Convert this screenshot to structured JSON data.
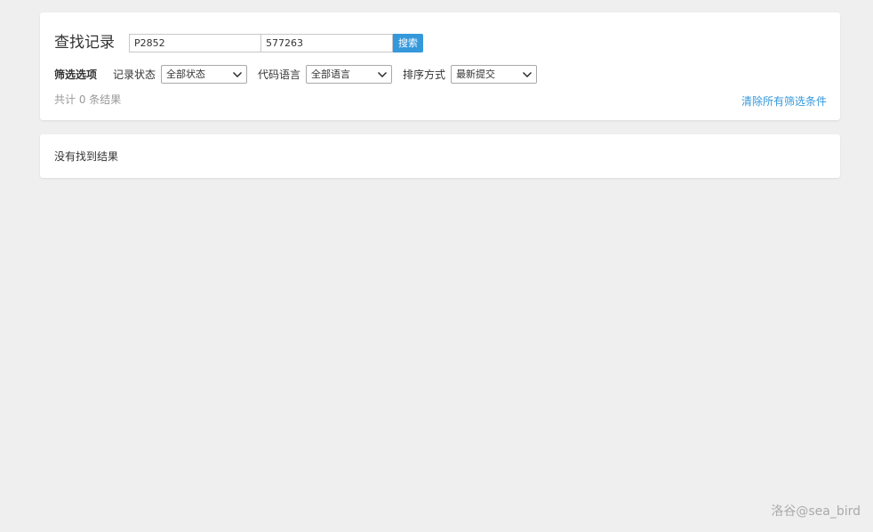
{
  "header": {
    "title": "查找记录",
    "search": {
      "problem_value": "P2852",
      "user_value": "577263",
      "button_label": "搜索"
    }
  },
  "filters": {
    "title": "筛选选项",
    "status": {
      "label": "记录状态",
      "selected": "全部状态"
    },
    "language": {
      "label": "代码语言",
      "selected": "全部语言"
    },
    "sort": {
      "label": "排序方式",
      "selected": "最新提交"
    }
  },
  "summary": {
    "count_text": "共计 0 条结果",
    "clear_label": "清除所有筛选条件"
  },
  "results": {
    "empty_message": "没有找到结果"
  },
  "watermark": "洛谷@sea_bird",
  "colors": {
    "accent": "#3498db",
    "background": "#efefef",
    "card": "#ffffff"
  }
}
